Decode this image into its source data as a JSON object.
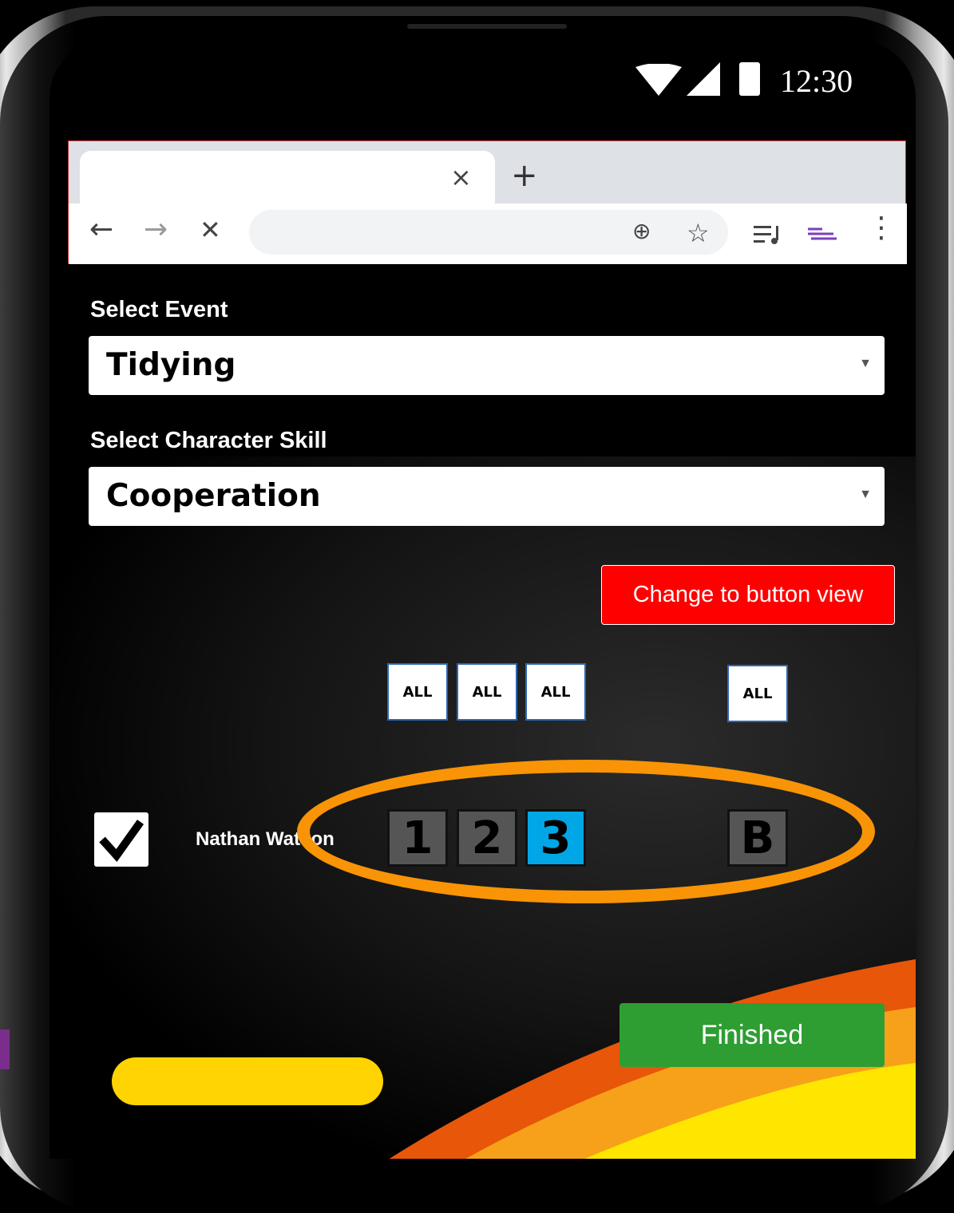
{
  "status_bar": {
    "time": "12:30",
    "icons": [
      "wifi-icon",
      "signal-icon",
      "battery-icon"
    ]
  },
  "browser": {
    "tab_close_symbol": "×",
    "new_tab_symbol": "+",
    "back_symbol": "←",
    "forward_symbol": "→",
    "stop_symbol": "✕",
    "zoom_symbol": "⊕",
    "bookmark_symbol": "☆",
    "menu_symbol": "⋮"
  },
  "form": {
    "event_label": "Select Event",
    "event_value": "Tidying",
    "skill_label": "Select Character Skill",
    "skill_value": "Cooperation",
    "dropdown_arrow": "▼"
  },
  "view_toggle_label": "Change to button view",
  "all_buttons": [
    "ALL",
    "ALL",
    "ALL",
    "ALL"
  ],
  "student": {
    "name": "Nathan Watson",
    "checked": true,
    "scores": [
      "1",
      "2",
      "3"
    ],
    "selected_score": "3",
    "extra_score": "B"
  },
  "finished_label": "Finished",
  "colors": {
    "red_button": "#ff0000",
    "selected_score": "#00a6e6",
    "highlight_ring": "#f89406",
    "finished_button": "#2e9e33"
  }
}
